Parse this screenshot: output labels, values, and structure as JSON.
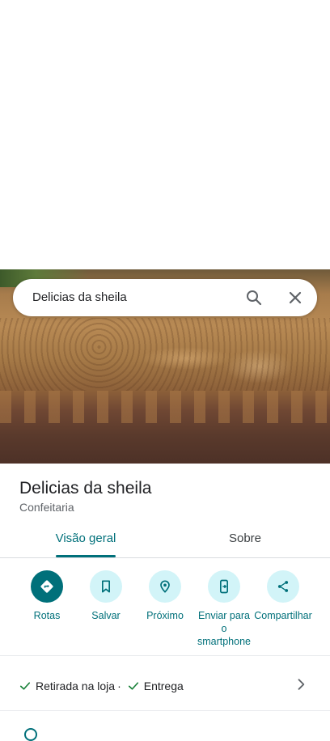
{
  "search": {
    "query": "Delicias da sheila"
  },
  "place": {
    "name": "Delicias da sheila",
    "category": "Confeitaria"
  },
  "tabs": [
    {
      "label": "Visão geral",
      "selected": true
    },
    {
      "label": "Sobre",
      "selected": false
    }
  ],
  "actions": [
    {
      "label": "Rotas",
      "icon": "directions-icon"
    },
    {
      "label": "Salvar",
      "icon": "bookmark-icon"
    },
    {
      "label": "Próximo",
      "icon": "nearby-icon"
    },
    {
      "label": "Enviar para o smartphone",
      "icon": "send-to-phone-icon"
    },
    {
      "label": "Compartilhar",
      "icon": "share-icon"
    }
  ],
  "services": {
    "pickup": "Retirada na loja",
    "separator": "·",
    "delivery": "Entrega"
  },
  "colors": {
    "accent": "#00707a",
    "accent_light": "#d2f4f8",
    "check": "#188038"
  }
}
